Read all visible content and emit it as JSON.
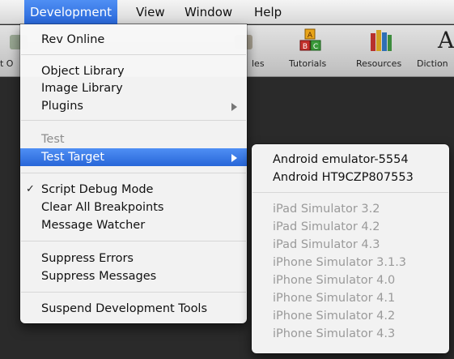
{
  "menubar": {
    "items": [
      "Development",
      "View",
      "Window",
      "Help"
    ]
  },
  "toolbar": {
    "partial_left": "t O",
    "partial_label": "les",
    "tutorials": "Tutorials",
    "resources": "Resources",
    "dictionary": "Diction"
  },
  "menu": {
    "rev_online": "Rev Online",
    "object_library": "Object Library",
    "image_library": "Image Library",
    "plugins": "Plugins",
    "test": "Test",
    "test_target": "Test Target",
    "check_mark": "✓",
    "script_debug_mode": "Script Debug Mode",
    "clear_all_breakpoints": "Clear All Breakpoints",
    "message_watcher": "Message Watcher",
    "suppress_errors": "Suppress Errors",
    "suppress_messages": "Suppress Messages",
    "suspend_dev_tools": "Suspend Development Tools"
  },
  "submenu": {
    "targets": [
      "Android emulator-5554",
      "Android HT9CZP807553"
    ],
    "simulators": [
      "iPad Simulator 3.2",
      "iPad Simulator 4.2",
      "iPad Simulator 4.3",
      "iPhone Simulator 3.1.3",
      "iPhone Simulator 4.0",
      "iPhone Simulator 4.1",
      "iPhone Simulator 4.2",
      "iPhone Simulator 4.3"
    ]
  },
  "colors": {
    "highlight": "#3a7ae8",
    "disabled_text": "#8d8d8d"
  }
}
